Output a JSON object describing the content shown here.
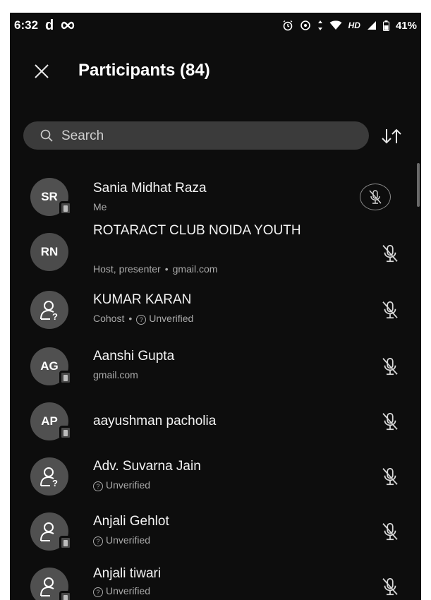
{
  "status_bar": {
    "time": "6:32",
    "app_letter": "d",
    "battery": "41%",
    "hd_label": "HD",
    "icons": [
      "infinity-icon",
      "alarm-icon",
      "data-saver-icon",
      "wifi-icon",
      "signal-icon",
      "battery-icon"
    ]
  },
  "header": {
    "title": "Participants (84)",
    "close_icon": "close-icon"
  },
  "search": {
    "placeholder": "Search"
  },
  "sort_icon": "sort-icon",
  "participants": [
    {
      "initials": "SR",
      "name": "Sania Midhat Raza",
      "sub": "Me",
      "avatar": "initials",
      "badge": true,
      "mic_outlined": true
    },
    {
      "initials": "RN",
      "name": "ROTARACT CLUB NOIDA YOUTH",
      "sub_parts": [
        "Host, presenter",
        "gmail.com"
      ],
      "avatar": "initials",
      "badge": false
    },
    {
      "initials": "",
      "name": "KUMAR KARAN",
      "sub_parts": [
        "Cohost",
        "Unverified"
      ],
      "avatar": "unknown",
      "badge": false
    },
    {
      "initials": "AG",
      "name": "Aanshi Gupta",
      "sub": "gmail.com",
      "avatar": "initials",
      "badge": true
    },
    {
      "initials": "AP",
      "name": "aayushman pacholia",
      "sub": "",
      "avatar": "initials",
      "badge": true
    },
    {
      "initials": "",
      "name": "Adv. Suvarna Jain",
      "sub": "Unverified",
      "avatar": "unknown",
      "badge": false
    },
    {
      "initials": "",
      "name": "Anjali Gehlot",
      "sub": "Unverified",
      "avatar": "unknown",
      "badge": true
    },
    {
      "initials": "",
      "name": "Anjali tiwari",
      "sub": "Unverified",
      "avatar": "unknown",
      "badge": true
    }
  ],
  "colors": {
    "background": "#0d0d0d",
    "search_bg": "#3b3b3b",
    "avatar_bg": "#505050",
    "subtext": "#a9a9a9"
  }
}
